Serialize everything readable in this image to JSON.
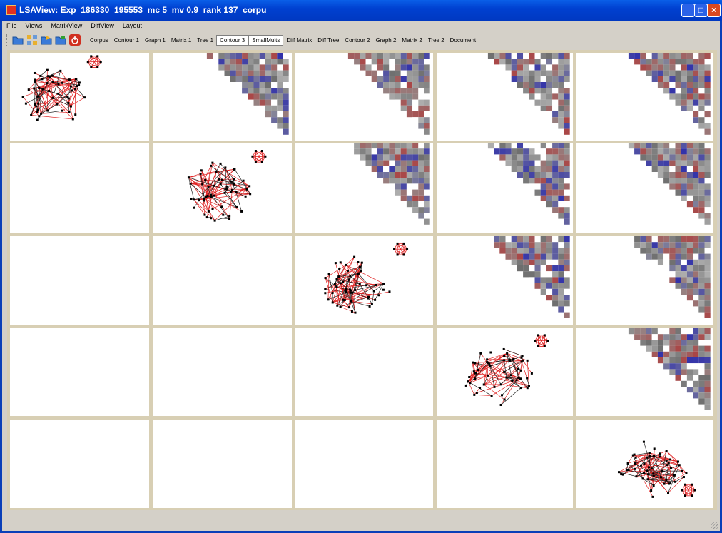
{
  "window": {
    "title": "LSAView: Exp_186330_195553_mc 5_mv 0.9_rank 137_corpu",
    "buttons": {
      "minimize": "_",
      "maximize": "□",
      "close": "×"
    }
  },
  "menu": [
    "File",
    "Views",
    "MatrixView",
    "DiffView",
    "Layout"
  ],
  "toolbar": {
    "icons": [
      "open-folder-icon",
      "grid-icon",
      "export-icon",
      "save-icon",
      "power-icon"
    ],
    "tabs": [
      "Corpus",
      "Contour 1",
      "Graph 1",
      "Matrix 1",
      "Tree 1",
      "Contour 3",
      "SmallMults",
      "Diff Matrix",
      "Diff Tree",
      "Contour 2",
      "Graph 2",
      "Matrix 2",
      "Tree 2",
      "Document"
    ],
    "pressed_tabs": [
      5,
      6
    ]
  },
  "small_multiples": {
    "rows": 5,
    "cols": 5,
    "diagonal": "graph",
    "upper": "matrix",
    "lower": "empty",
    "colors": {
      "graph_node": "#000000",
      "graph_edge_cluster": "#e02020",
      "graph_edge_link": "#202020",
      "matrix_high": "#2a2aa8",
      "matrix_low": "#a83a3a",
      "matrix_neutral": "#8a8a8a",
      "gutter": "#d8cfb4"
    }
  }
}
